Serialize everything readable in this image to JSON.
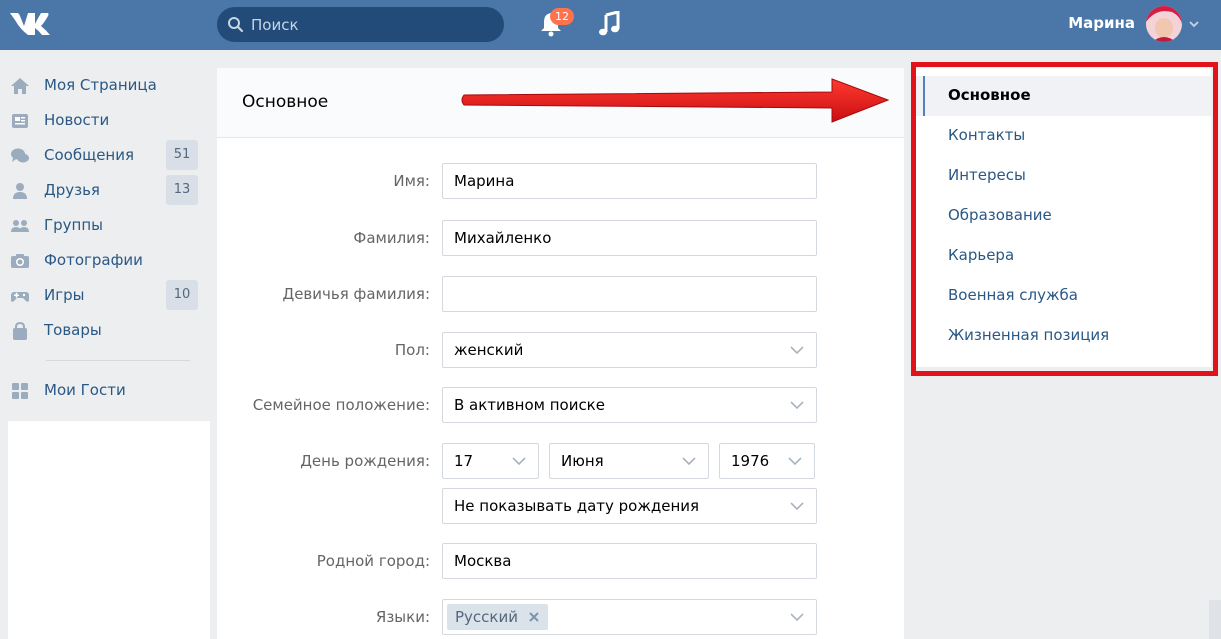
{
  "header": {
    "search_placeholder": "Поиск",
    "notifications_count": "12",
    "user_name": "Марина"
  },
  "sidebar": {
    "items": [
      {
        "label": "Моя Страница",
        "icon": "home-icon",
        "count": ""
      },
      {
        "label": "Новости",
        "icon": "news-icon",
        "count": ""
      },
      {
        "label": "Сообщения",
        "icon": "messages-icon",
        "count": "51"
      },
      {
        "label": "Друзья",
        "icon": "friends-icon",
        "count": "13"
      },
      {
        "label": "Группы",
        "icon": "groups-icon",
        "count": ""
      },
      {
        "label": "Фотографии",
        "icon": "camera-icon",
        "count": ""
      },
      {
        "label": "Игры",
        "icon": "gamepad-icon",
        "count": "10"
      },
      {
        "label": "Товары",
        "icon": "bag-icon",
        "count": ""
      }
    ],
    "extra": {
      "label": "Мои Гости",
      "icon": "apps-icon"
    }
  },
  "main": {
    "title": "Основное",
    "fields": {
      "first_name": {
        "label": "Имя:",
        "value": "Марина"
      },
      "last_name": {
        "label": "Фамилия:",
        "value": "Михайленко"
      },
      "maiden_name": {
        "label": "Девичья фамилия:",
        "value": ""
      },
      "gender": {
        "label": "Пол:",
        "value": "женский"
      },
      "relationship": {
        "label": "Семейное положение:",
        "value": "В активном поиске"
      },
      "birthday": {
        "label": "День рождения:",
        "day": "17",
        "month": "Июня",
        "year": "1976",
        "visibility": "Не показывать дату рождения"
      },
      "hometown": {
        "label": "Родной город:",
        "value": "Москва"
      },
      "languages": {
        "label": "Языки:",
        "tags": [
          "Русский"
        ]
      }
    }
  },
  "right_menu": {
    "items": [
      "Основное",
      "Контакты",
      "Интересы",
      "Образование",
      "Карьера",
      "Военная служба",
      "Жизненная позиция"
    ],
    "active_index": 0
  },
  "colors": {
    "header": "#4a76a8",
    "link": "#2a5885",
    "highlight_frame": "#e1121a",
    "arrow": "#e1121a"
  }
}
